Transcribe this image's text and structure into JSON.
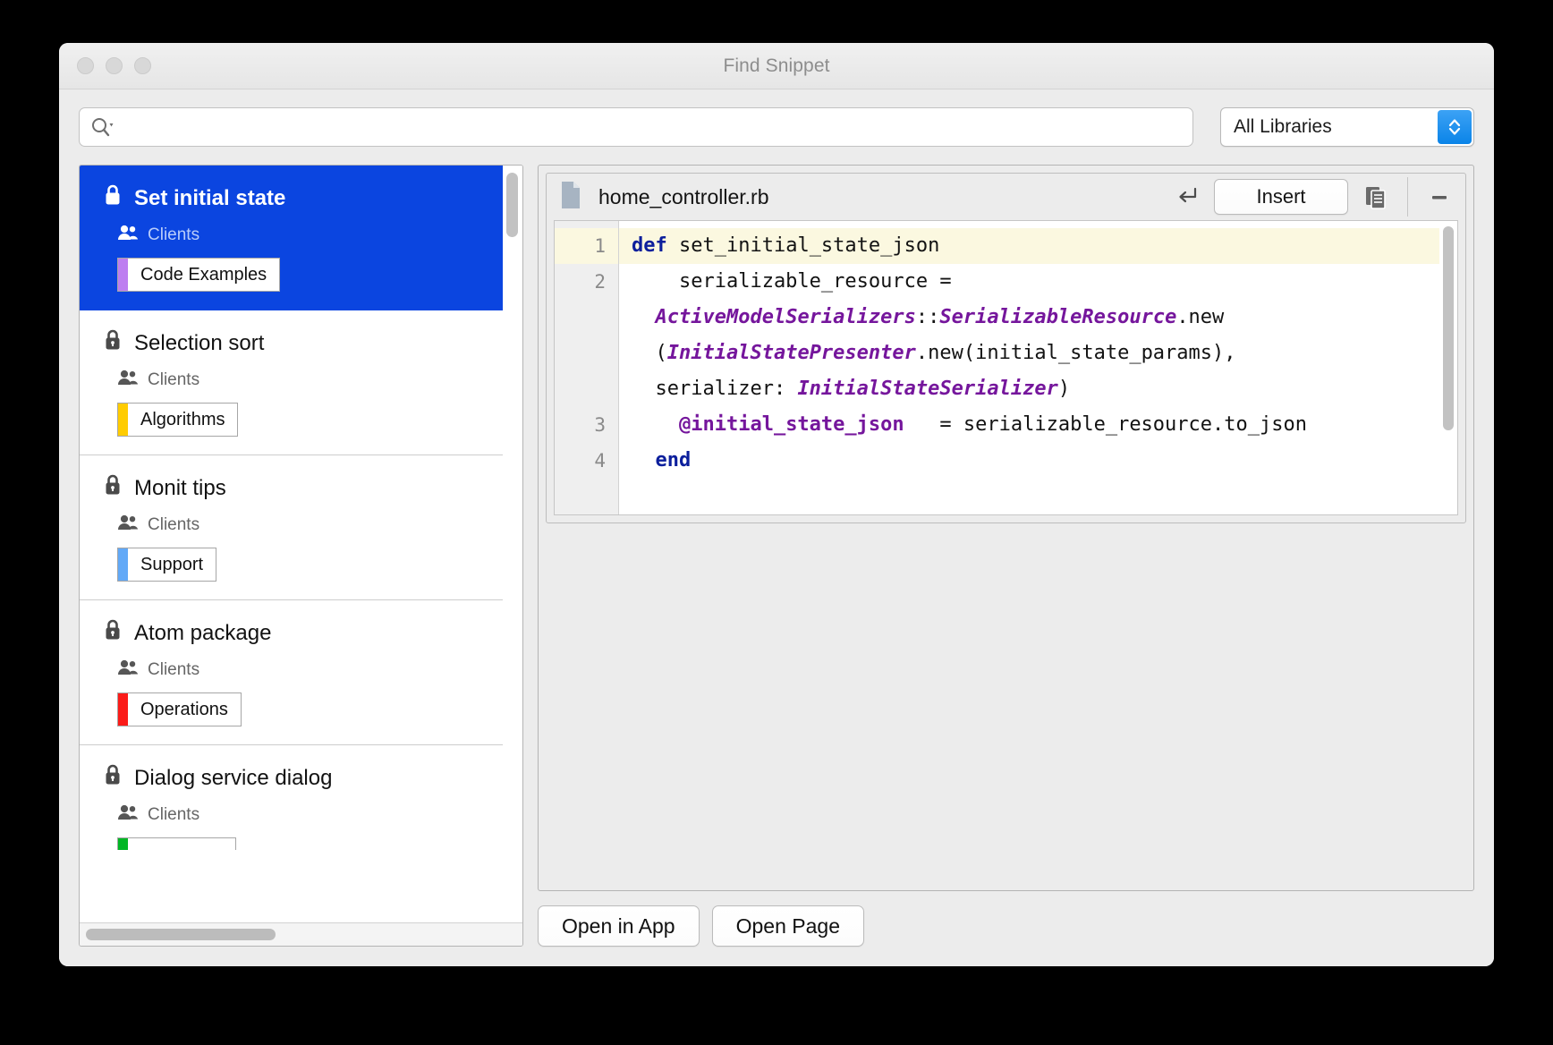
{
  "window": {
    "title": "Find Snippet",
    "traffic_lights": [
      "close",
      "minimize",
      "zoom"
    ]
  },
  "search": {
    "value": "",
    "placeholder": "",
    "icon": "search-icon"
  },
  "library_filter": {
    "selected": "All Libraries",
    "icon": "chevron-up-down-icon"
  },
  "sidebar": {
    "items": [
      {
        "title": "Set initial state",
        "lock_icon": "lock-icon",
        "group_icon": "people-icon",
        "group": "Clients",
        "tag": "Code Examples",
        "tag_color": "#bd7ef0",
        "selected": true
      },
      {
        "title": "Selection sort",
        "lock_icon": "lock-icon",
        "group_icon": "people-icon",
        "group": "Clients",
        "tag": "Algorithms",
        "tag_color": "#ffcc00",
        "selected": false
      },
      {
        "title": "Monit tips",
        "lock_icon": "lock-icon",
        "group_icon": "people-icon",
        "group": "Clients",
        "tag": "Support",
        "tag_color": "#62a9f7",
        "selected": false
      },
      {
        "title": "Atom package",
        "lock_icon": "lock-icon",
        "group_icon": "people-icon",
        "group": "Clients",
        "tag": "Operations",
        "tag_color": "#fb1b18",
        "selected": false
      },
      {
        "title": "Dialog service dialog",
        "lock_icon": "lock-icon",
        "group_icon": "people-icon",
        "group": "Clients",
        "tag": "",
        "tag_color": "#00b624",
        "selected": false
      }
    ]
  },
  "snippet": {
    "file_icon": "file-icon",
    "file_name": "home_controller.rb",
    "return_icon": "return-arrow-icon",
    "insert_label": "Insert",
    "copy_icon": "copy-icon",
    "collapse_icon": "minus-icon",
    "highlight_line": 1,
    "gutter": [
      "1",
      "2",
      "",
      "",
      "",
      "3",
      "4"
    ],
    "code_lines": [
      {
        "n": "1",
        "highlighted": true,
        "tokens": [
          {
            "t": "def",
            "c": "kw"
          },
          {
            "t": " set_initial_state_json",
            "c": ""
          }
        ]
      },
      {
        "n": "2",
        "highlighted": false,
        "tokens": [
          {
            "t": "    serializable_resource =",
            "c": ""
          }
        ]
      },
      {
        "n": "",
        "highlighted": false,
        "tokens": [
          {
            "t": "  ",
            "c": ""
          },
          {
            "t": "ActiveModelSerializers",
            "c": "cls"
          },
          {
            "t": "::",
            "c": ""
          },
          {
            "t": "SerializableResource",
            "c": "cls"
          },
          {
            "t": ".new",
            "c": ""
          }
        ]
      },
      {
        "n": "",
        "highlighted": false,
        "tokens": [
          {
            "t": "  (",
            "c": ""
          },
          {
            "t": "InitialStatePresenter",
            "c": "cls"
          },
          {
            "t": ".new(initial_state_params),",
            "c": ""
          }
        ]
      },
      {
        "n": "",
        "highlighted": false,
        "tokens": [
          {
            "t": "  serializer: ",
            "c": ""
          },
          {
            "t": "InitialStateSerializer",
            "c": "cls"
          },
          {
            "t": ")",
            "c": ""
          }
        ]
      },
      {
        "n": "3",
        "highlighted": false,
        "tokens": [
          {
            "t": "    ",
            "c": ""
          },
          {
            "t": "@initial_state_json",
            "c": "ivar"
          },
          {
            "t": "   = serializable_resource.to_json",
            "c": ""
          }
        ]
      },
      {
        "n": "4",
        "highlighted": false,
        "tokens": [
          {
            "t": "  ",
            "c": ""
          },
          {
            "t": "end",
            "c": "kw"
          }
        ]
      }
    ]
  },
  "footer": {
    "open_in_app": "Open in App",
    "open_page": "Open Page"
  },
  "colors": {
    "selection_blue": "#0b45e0",
    "accent_blue": "#0a84e8",
    "code_keyword": "#0c1f9c",
    "code_class": "#75169c",
    "line_highlight": "#fbf8e0"
  }
}
